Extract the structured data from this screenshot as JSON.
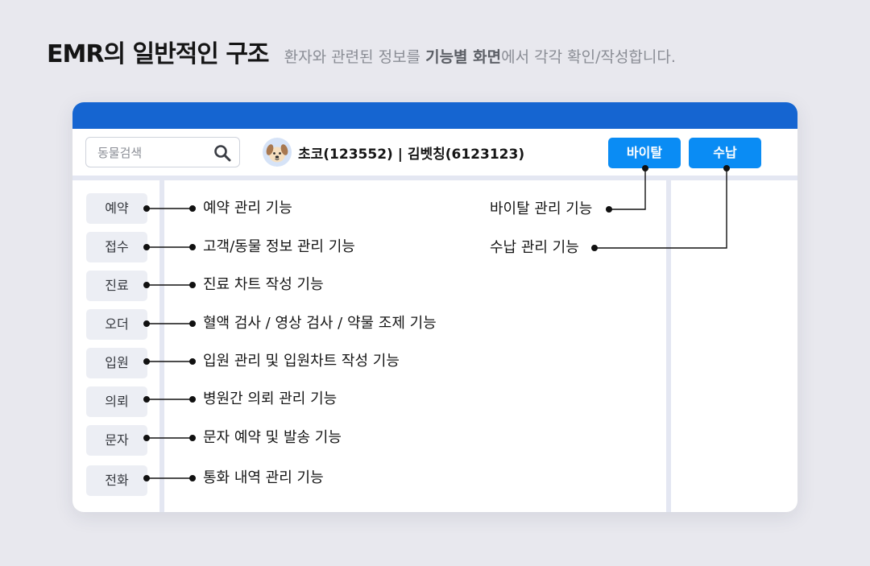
{
  "heading": {
    "title": "EMR의 일반적인 구조",
    "sub_before": "환자와 관련된 정보를 ",
    "sub_bold": "기능별 화면",
    "sub_after": "에서 각각 확인/작성합니다."
  },
  "search": {
    "placeholder": "동물검색",
    "icon": "search-icon"
  },
  "patient": {
    "avatar_icon": "dog-face-icon",
    "info": "초코(123552)  |  김벳칭(6123123)"
  },
  "buttons": {
    "vital": "바이탈",
    "payment": "수납"
  },
  "sidebar": [
    {
      "label": "예약",
      "desc": "예약 관리 기능"
    },
    {
      "label": "접수",
      "desc": "고객/동물 정보 관리 기능"
    },
    {
      "label": "진료",
      "desc": "진료 차트 작성 기능"
    },
    {
      "label": "오더",
      "desc": "혈액 검사 / 영상 검사 / 약물 조제 기능"
    },
    {
      "label": "입원",
      "desc": "입원 관리 및 입원차트 작성 기능"
    },
    {
      "label": "의뢰",
      "desc": "병원간 의뢰 관리 기능"
    },
    {
      "label": "문자",
      "desc": "문자 예약 및 발송 기능"
    },
    {
      "label": "전화",
      "desc": "통화 내역 관리 기능"
    }
  ],
  "right_labels": {
    "vital": "바이탈 관리 기능",
    "payment": "수납 관리 기능"
  },
  "colors": {
    "accent": "#0a8cf4",
    "titlebar": "#1565d1",
    "background": "#e8e8ee"
  }
}
